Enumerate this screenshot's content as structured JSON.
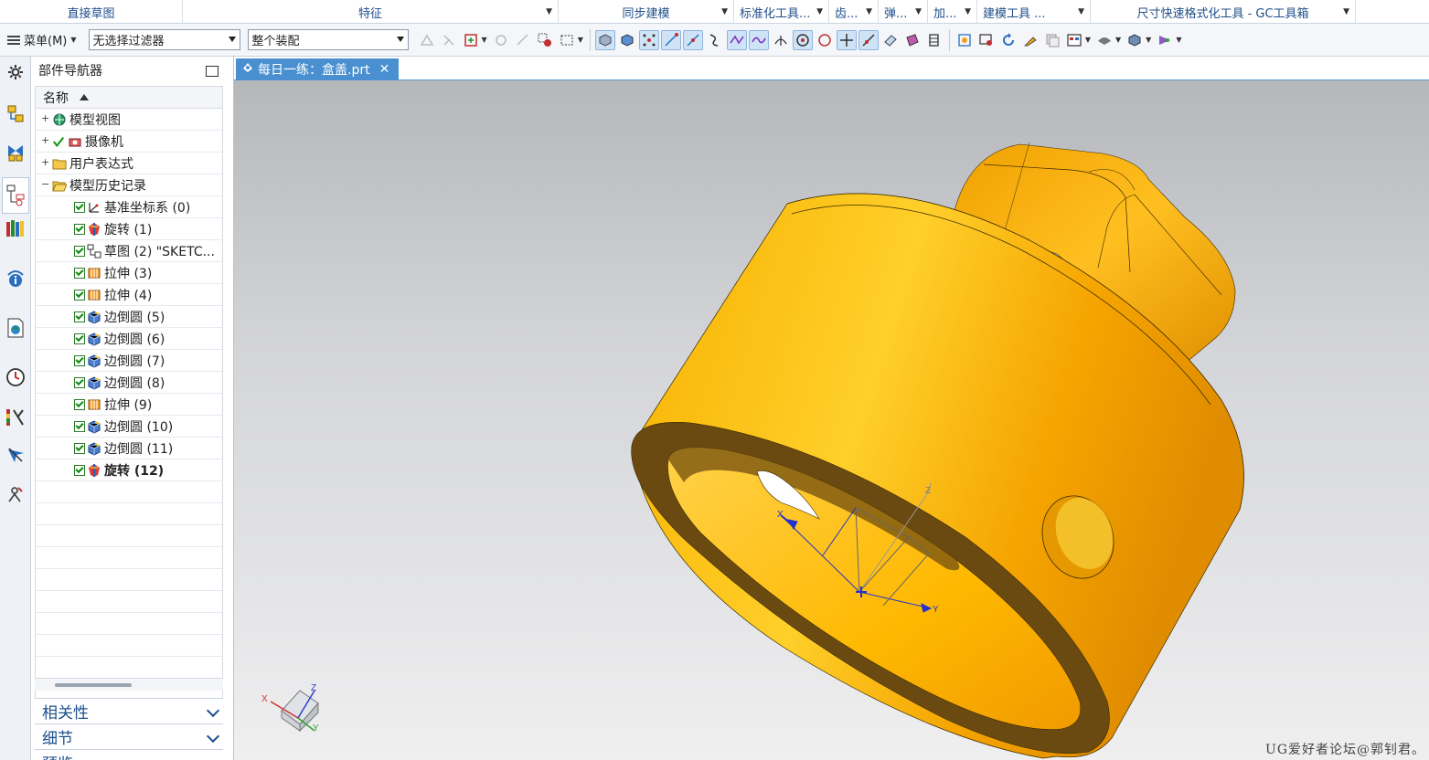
{
  "ribbon": {
    "groups": [
      {
        "label": "直接草图"
      },
      {
        "label": "特征"
      },
      {
        "label": "同步建模"
      },
      {
        "label": "标准化工具..."
      },
      {
        "label": "齿..."
      },
      {
        "label": "弹..."
      },
      {
        "label": "加..."
      },
      {
        "label": "建模工具 ..."
      },
      {
        "label": "尺寸快速格式化工具 - GC工具箱"
      }
    ]
  },
  "toolbar": {
    "menu_label": "菜单(M)",
    "filter_value": "无选择过滤器",
    "scope_value": "整个装配"
  },
  "navigator": {
    "title": "部件导航器",
    "column_header": "名称",
    "top_items": [
      {
        "label": "模型视图"
      },
      {
        "label": "摄像机"
      },
      {
        "label": "用户表达式"
      },
      {
        "label": "模型历史记录"
      }
    ],
    "history": [
      {
        "label": "基准坐标系 (0)",
        "icon": "datum-csys-icon"
      },
      {
        "label": "旋转 (1)",
        "icon": "revolve-icon"
      },
      {
        "label": "草图 (2) \"SKETC...",
        "icon": "sketch-icon"
      },
      {
        "label": "拉伸 (3)",
        "icon": "extrude-icon"
      },
      {
        "label": "拉伸 (4)",
        "icon": "extrude-icon"
      },
      {
        "label": "边倒圆 (5)",
        "icon": "edge-blend-icon"
      },
      {
        "label": "边倒圆 (6)",
        "icon": "edge-blend-icon"
      },
      {
        "label": "边倒圆 (7)",
        "icon": "edge-blend-icon"
      },
      {
        "label": "边倒圆 (8)",
        "icon": "edge-blend-icon"
      },
      {
        "label": "拉伸 (9)",
        "icon": "extrude-icon"
      },
      {
        "label": "边倒圆 (10)",
        "icon": "edge-blend-icon"
      },
      {
        "label": "边倒圆 (11)",
        "icon": "edge-blend-icon"
      },
      {
        "label": "旋转 (12)",
        "icon": "revolve-icon"
      }
    ],
    "sections": [
      {
        "label": "相关性"
      },
      {
        "label": "细节"
      },
      {
        "label": "预览"
      }
    ]
  },
  "tab": {
    "label": "每日一练：盒盖.prt"
  },
  "viewport": {
    "axis_labels": {
      "x": "X",
      "y": "Y",
      "z": "Z"
    },
    "watermark": "UG爱好者论坛@郭钊君。",
    "part_color": "#f5a800"
  },
  "colors": {
    "accent": "#4a90d0",
    "ribbon_text": "#1f4e8a",
    "section_text": "#1c4f8c"
  }
}
